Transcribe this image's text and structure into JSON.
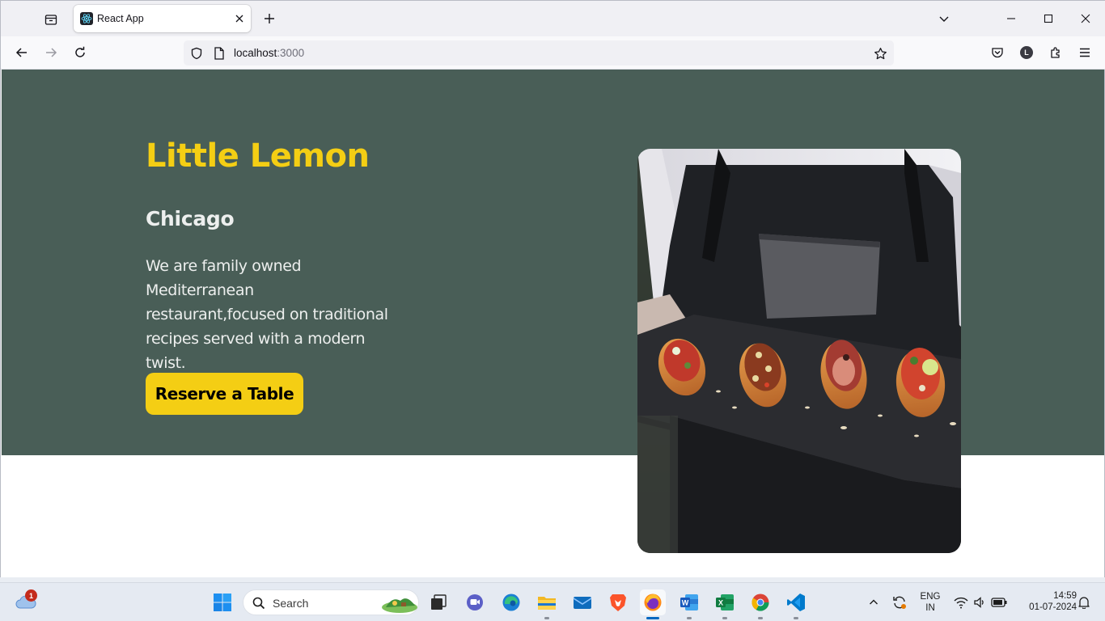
{
  "browser": {
    "tab": {
      "title": "React App"
    },
    "url": {
      "host": "localhost",
      "port": ":3000"
    }
  },
  "hero": {
    "title": "Little Lemon",
    "subtitle": "Chicago",
    "description": "We are family owned Mediterranean restaurant,focused on traditional recipes served with a modern twist.",
    "cta_label": "Reserve a Table",
    "image_icon": "food-platter-photo",
    "colors": {
      "background": "#495e57",
      "accent": "#f4ce14",
      "text": "#edefee"
    }
  },
  "taskbar": {
    "search_label": "Search",
    "weather_badge": "1",
    "language": {
      "top": "ENG",
      "bottom": "IN"
    },
    "clock": {
      "time": "14:59",
      "date": "01-07-2024"
    }
  }
}
